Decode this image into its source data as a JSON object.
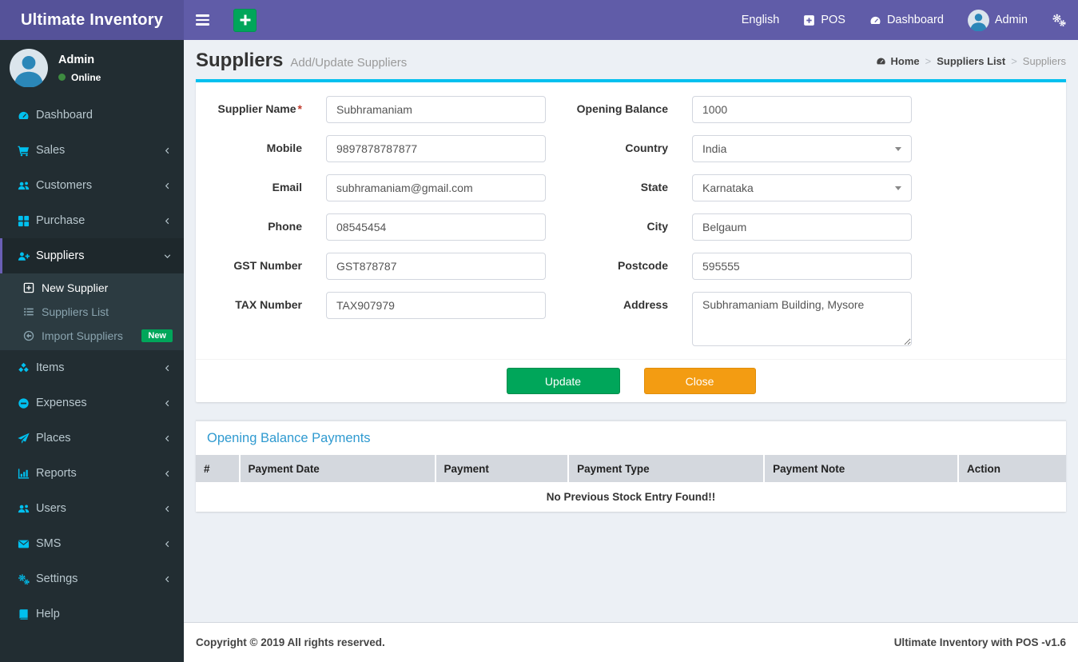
{
  "colors": {
    "navbar": "#605ca8",
    "brand_bg": "#555299",
    "sidebar": "#222d32",
    "sidebar_icon": "#00c0ef",
    "accent_line": "#00c0ef",
    "success": "#00a65a",
    "warning": "#f39c12",
    "link_blue": "#2f9ad0"
  },
  "topbar": {
    "brand": "Ultimate Inventory",
    "language": "English",
    "pos": "POS",
    "dashboard": "Dashboard",
    "user": "Admin"
  },
  "sidebar": {
    "user": {
      "name": "Admin",
      "status": "Online"
    },
    "items": [
      {
        "label": "Dashboard",
        "icon": "gauge-icon"
      },
      {
        "label": "Sales",
        "icon": "cart-icon"
      },
      {
        "label": "Customers",
        "icon": "users-icon"
      },
      {
        "label": "Purchase",
        "icon": "grid-icon"
      },
      {
        "label": "Suppliers",
        "icon": "user-plus-icon"
      },
      {
        "label": "Items",
        "icon": "cubes-icon"
      },
      {
        "label": "Expenses",
        "icon": "minus-circle-icon"
      },
      {
        "label": "Places",
        "icon": "send-icon"
      },
      {
        "label": "Reports",
        "icon": "bar-chart-icon"
      },
      {
        "label": "Users",
        "icon": "users-icon"
      },
      {
        "label": "SMS",
        "icon": "envelope-icon"
      },
      {
        "label": "Settings",
        "icon": "cogs-icon"
      },
      {
        "label": "Help",
        "icon": "book-icon"
      }
    ],
    "suppliers_submenu": [
      {
        "label": "New Supplier",
        "icon": "plus-square-icon"
      },
      {
        "label": "Suppliers List",
        "icon": "list-icon"
      },
      {
        "label": "Import Suppliers",
        "icon": "import-icon",
        "badge": "New"
      }
    ]
  },
  "page": {
    "title": "Suppliers",
    "subtitle": "Add/Update Suppliers",
    "breadcrumb": {
      "home": "Home",
      "parent": "Suppliers List",
      "current": "Suppliers"
    }
  },
  "form": {
    "required_mark": "*",
    "left": [
      {
        "label": "Supplier Name",
        "value": "Subhramaniam"
      },
      {
        "label": "Mobile",
        "value": "9897878787877"
      },
      {
        "label": "Email",
        "value": "subhramaniam@gmail.com"
      },
      {
        "label": "Phone",
        "value": "08545454"
      },
      {
        "label": "GST Number",
        "value": "GST878787"
      },
      {
        "label": "TAX Number",
        "value": "TAX907979"
      }
    ],
    "right": [
      {
        "label": "Opening Balance",
        "value": "1000"
      },
      {
        "label": "Country",
        "value": "India"
      },
      {
        "label": "State",
        "value": "Karnataka"
      },
      {
        "label": "City",
        "value": "Belgaum"
      },
      {
        "label": "Postcode",
        "value": "595555"
      },
      {
        "label": "Address",
        "value": "Subhramaniam Building, Mysore"
      }
    ],
    "buttons": {
      "update": "Update",
      "close": "Close"
    }
  },
  "payments": {
    "title": "Opening Balance Payments",
    "columns": [
      "#",
      "Payment Date",
      "Payment",
      "Payment Type",
      "Payment Note",
      "Action"
    ],
    "empty_message": "No Previous Stock Entry Found!!"
  },
  "footer": {
    "left": "Copyright © 2019 All rights reserved.",
    "right": "Ultimate Inventory with POS -v1.6"
  }
}
